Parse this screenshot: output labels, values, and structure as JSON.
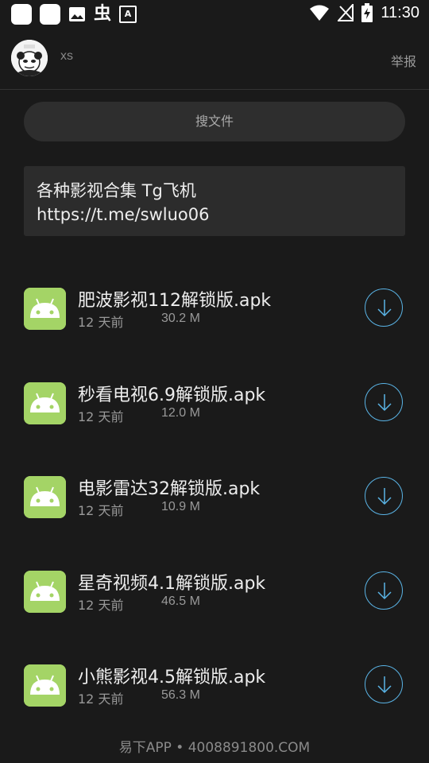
{
  "status_bar": {
    "time": "11:30",
    "left_icons": [
      "app-square-icon",
      "app-square-icon",
      "image-icon",
      "bug-icon",
      "a-box-icon"
    ],
    "right_icons": [
      "wifi-icon",
      "no-signal-icon",
      "battery-charging-icon"
    ]
  },
  "header": {
    "username": "xs",
    "report_label": "举报"
  },
  "search": {
    "label": "搜文件"
  },
  "notice": {
    "line1": "各种影视合集 Tg飞机",
    "line2": "https://t.me/swluo06"
  },
  "files": [
    {
      "name": "肥波影视112解锁版.apk",
      "age": "12 天前",
      "size": "30.2 M"
    },
    {
      "name": "秒看电视6.9解锁版.apk",
      "age": "12 天前",
      "size": "12.0 M"
    },
    {
      "name": "电影雷达32解锁版.apk",
      "age": "12 天前",
      "size": "10.9 M"
    },
    {
      "name": "星奇视频4.1解锁版.apk",
      "age": "12 天前",
      "size": "46.5 M"
    },
    {
      "name": "小熊影视4.5解锁版.apk",
      "age": "12 天前",
      "size": "56.3 M"
    }
  ],
  "watermark": "易下APP • 4008891800.COM",
  "colors": {
    "background": "#1a1a1a",
    "accent": "#5ab4e6",
    "android_green": "#a4d466"
  }
}
